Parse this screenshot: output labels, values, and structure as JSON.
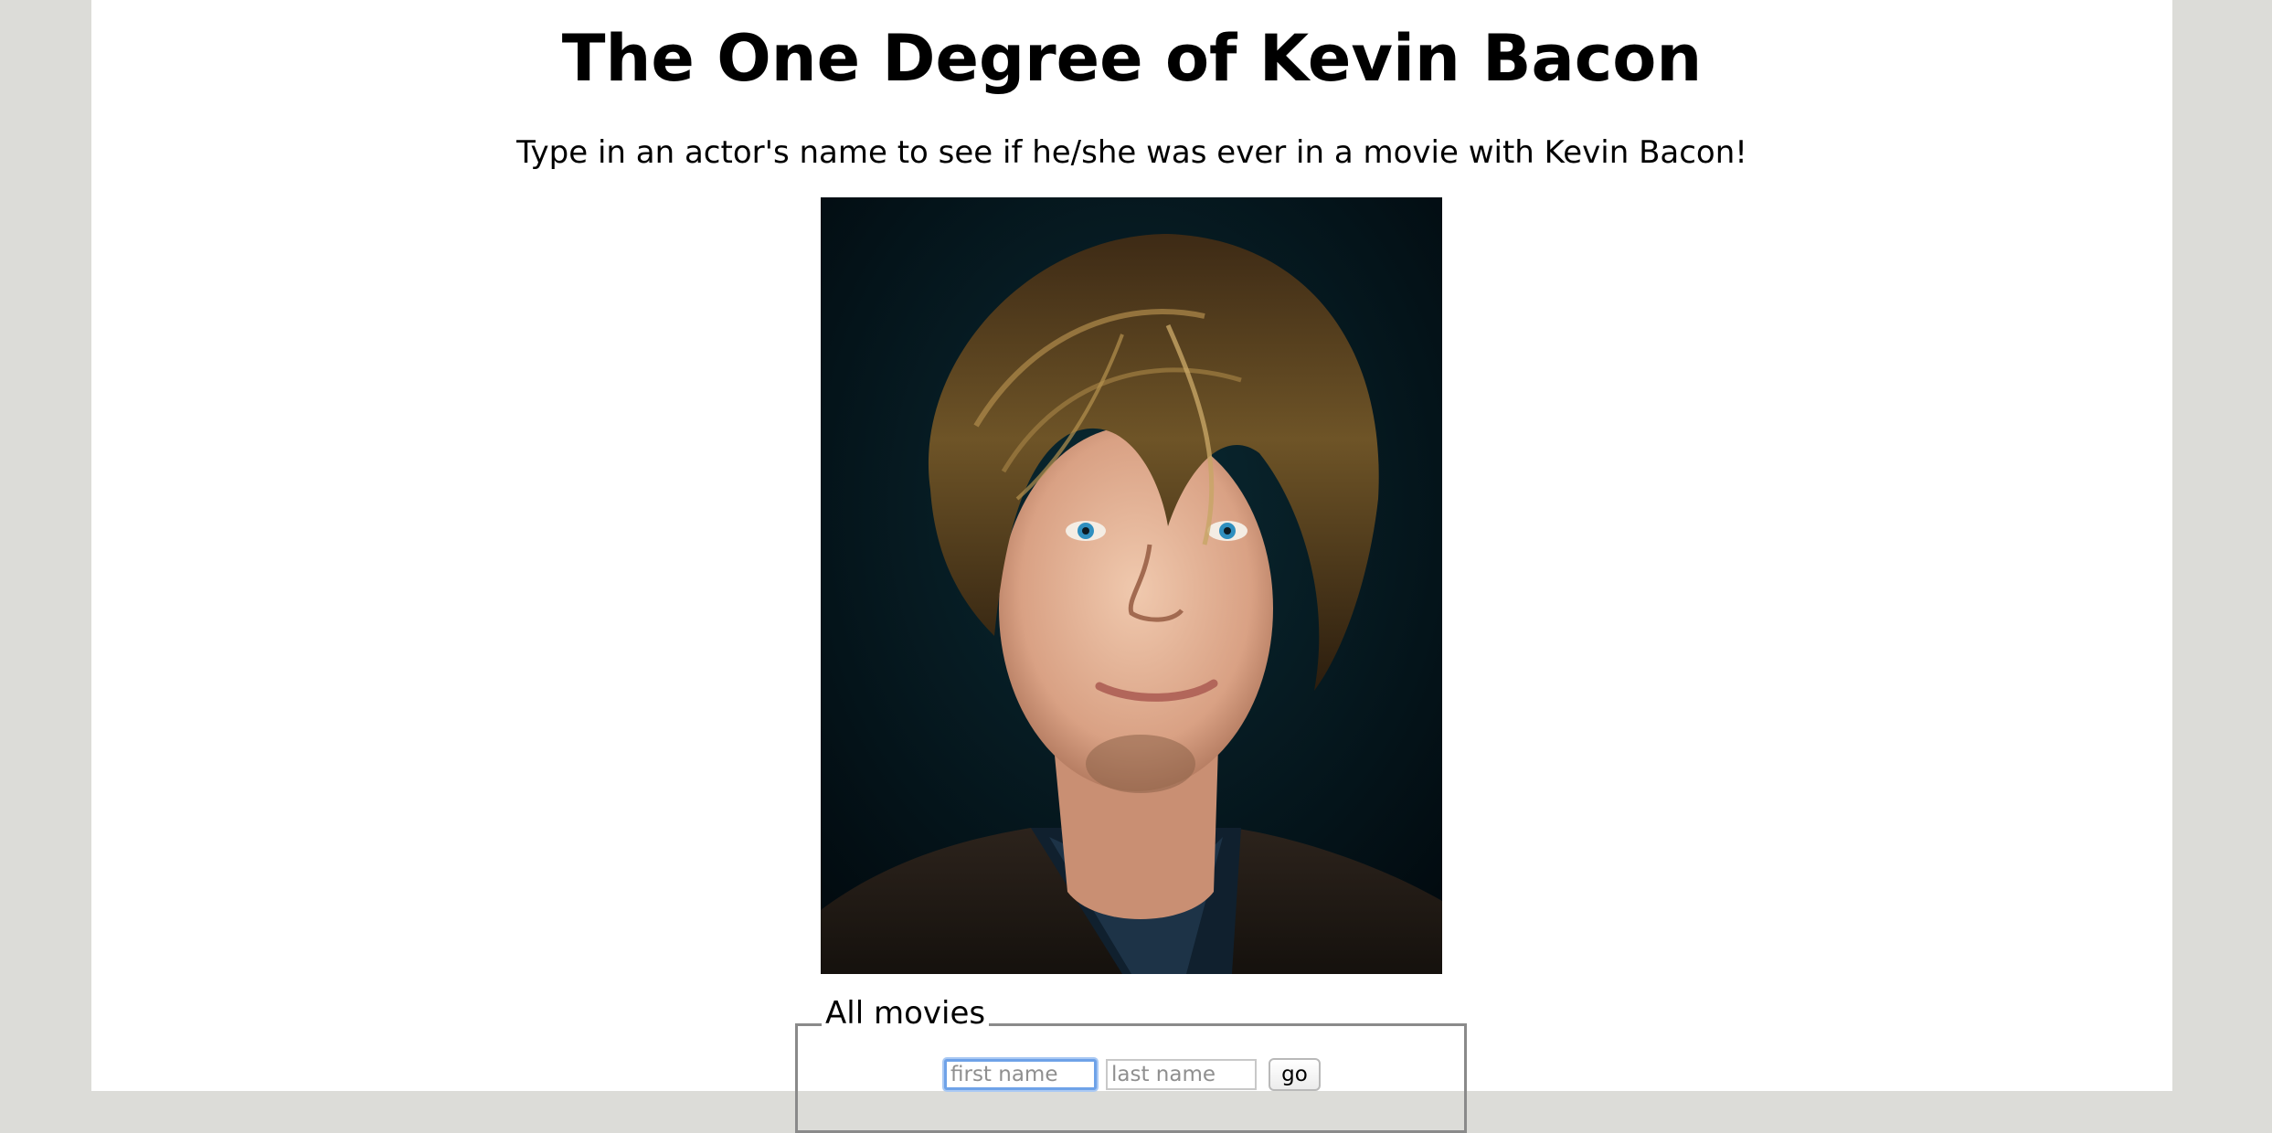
{
  "header": {
    "title": "The One Degree of Kevin Bacon",
    "subtitle": "Type in an actor's name to see if he/she was ever in a movie with Kevin Bacon!"
  },
  "photo": {
    "subject": "kevin-bacon-portrait"
  },
  "search": {
    "legend": "All movies",
    "first_name": {
      "value": "",
      "placeholder": "first name"
    },
    "last_name": {
      "value": "",
      "placeholder": "last name"
    },
    "submit_label": "go"
  },
  "colors": {
    "background": "#dcdcd8",
    "page": "#ffffff",
    "focus_ring": "#6ea2e8"
  }
}
